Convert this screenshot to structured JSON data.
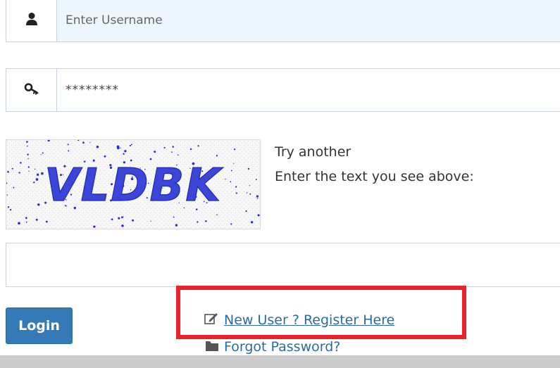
{
  "login_form": {
    "username": {
      "placeholder": "Enter Username",
      "icon": "user-icon"
    },
    "password": {
      "placeholder": "********",
      "icon": "key-icon"
    },
    "captcha": {
      "image_text": "VLDBK",
      "try_another": "Try another",
      "instruction": "Enter the text you see above:",
      "input_value": ""
    },
    "login_label": "Login",
    "register_link": {
      "label": "New User ? Register Here",
      "icon": "edit-icon"
    },
    "forgot_link": {
      "label": "Forgot Password?",
      "icon": "folder-icon"
    }
  },
  "colors": {
    "primary": "#337ab7",
    "link": "#2a6aa8",
    "highlight": "#e8222b",
    "username_bg": "#eef6fd",
    "border": "#c9d3df"
  }
}
